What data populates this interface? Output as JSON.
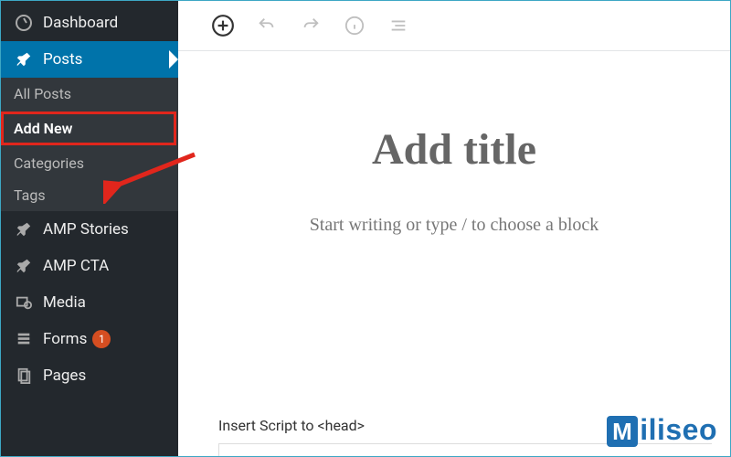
{
  "sidebar": {
    "dashboard": "Dashboard",
    "posts": "Posts",
    "sub": {
      "all_posts": "All Posts",
      "add_new": "Add New",
      "categories": "Categories",
      "tags": "Tags"
    },
    "amp_stories": "AMP Stories",
    "amp_cta": "AMP CTA",
    "media": "Media",
    "forms": "Forms",
    "forms_badge": "1",
    "pages": "Pages"
  },
  "editor": {
    "title_placeholder": "Add title",
    "body_placeholder": "Start writing or type / to choose a block"
  },
  "meta": {
    "insert_head": "Insert Script to <head>"
  },
  "watermark": {
    "m": "M",
    "rest": "iliseo"
  }
}
